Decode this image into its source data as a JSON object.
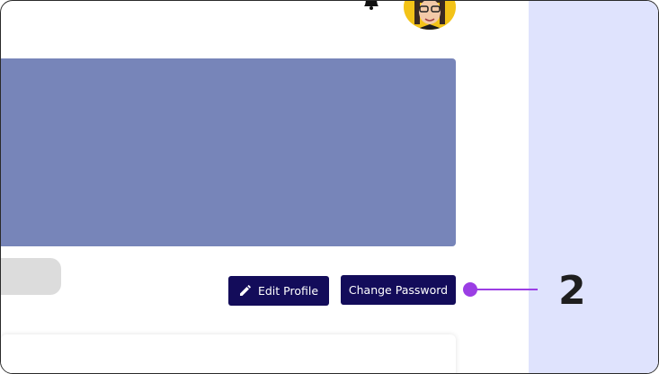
{
  "actions": {
    "edit_profile_label": "Edit Profile",
    "change_password_label": "Change Password"
  },
  "annotation": {
    "step_number": "2"
  },
  "icons": {
    "bell": "bell-icon",
    "pencil": "pencil-icon",
    "avatar": "avatar"
  },
  "colors": {
    "button_bg": "#130c5a",
    "banner": "#7785b9",
    "right_panel": "#dfe3fd",
    "callout": "#9b3ee4"
  }
}
